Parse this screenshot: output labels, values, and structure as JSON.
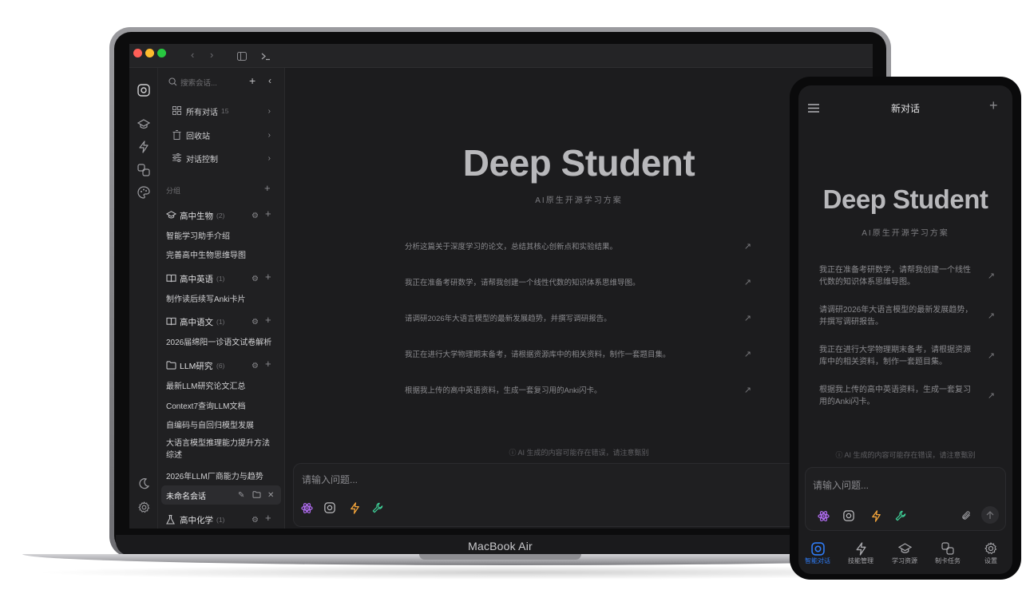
{
  "laptop": {
    "model_label": "MacBook Air"
  },
  "desktop": {
    "search": {
      "placeholder": "搜索会话..."
    },
    "nav": [
      {
        "icon": "grid-icon",
        "label": "所有对话",
        "count": "15"
      },
      {
        "icon": "trash-icon",
        "label": "回收站",
        "count": ""
      },
      {
        "icon": "sliders-icon",
        "label": "对话控制",
        "count": ""
      }
    ],
    "group_header": "分组",
    "groups": [
      {
        "icon": "graduation-cap-icon",
        "name": "高中生物",
        "count": "(2)",
        "items": [
          "智能学习助手介绍",
          "完善高中生物思维导图"
        ]
      },
      {
        "icon": "book-icon",
        "name": "高中英语",
        "count": "(1)",
        "items": [
          "制作读后续写Anki卡片"
        ]
      },
      {
        "icon": "book-icon",
        "name": "高中语文",
        "count": "(1)",
        "items": [
          "2026届绵阳一诊语文试卷解析"
        ]
      },
      {
        "icon": "folder-icon",
        "name": "LLM研究",
        "count": "(6)",
        "items": [
          "最新LLM研究论文汇总",
          "Context7查询LLM文档",
          "自编码与自回归模型发展",
          "大语言模型推理能力提升方法综述",
          "2026年LLM厂商能力与趋势"
        ]
      }
    ],
    "active_item": "未命名会话",
    "last_group": {
      "icon": "flask-icon",
      "name": "高中化学",
      "count": "(1)"
    },
    "hero": {
      "title": "Deep Student",
      "subtitle": "AI原生开源学习方案"
    },
    "suggestions": [
      "分析这篇关于深度学习的论文，总结其核心创新点和实验结果。",
      "我正在准备考研数学，请帮我创建一个线性代数的知识体系思维导图。",
      "请调研2026年大语言模型的最新发展趋势，并撰写调研报告。",
      "我正在进行大学物理期末备考，请根据资源库中的相关资料，制作一套题目集。",
      "根据我上传的高中英语资料，生成一套复习用的Anki闪卡。"
    ],
    "disclaimer": "AI 生成的内容可能存在错误，请注意甄别",
    "input_placeholder": "请输入问题..."
  },
  "phone": {
    "header_title": "新对话",
    "hero": {
      "title": "Deep Student",
      "subtitle": "AI原生开源学习方案"
    },
    "suggestions": [
      "我正在准备考研数学，请帮我创建一个线性代数的知识体系思维导图。",
      "请调研2026年大语言模型的最新发展趋势，并撰写调研报告。",
      "我正在进行大学物理期末备考，请根据资源库中的相关资料，制作一套题目集。",
      "根据我上传的高中英语资料，生成一套复习用的Anki闪卡。"
    ],
    "disclaimer": "AI 生成的内容可能存在错误，请注意甄别",
    "input_placeholder": "请输入问题...",
    "tabs": [
      {
        "icon": "chat-icon",
        "label": "智能对话",
        "active": true
      },
      {
        "icon": "lightning-icon",
        "label": "技能管理",
        "active": false
      },
      {
        "icon": "graduation-cap-icon",
        "label": "学习资源",
        "active": false
      },
      {
        "icon": "cards-icon",
        "label": "制卡任务",
        "active": false
      },
      {
        "icon": "gear-icon",
        "label": "设置",
        "active": false
      }
    ]
  },
  "colors": {
    "accent_blue": "#2f7cf6",
    "tool_purple": "#b06cf0",
    "tool_orange": "#f0a23a",
    "tool_green": "#3fd39a",
    "window_red": "#fe5f57",
    "window_yellow": "#febc2e",
    "window_green": "#28c840"
  }
}
